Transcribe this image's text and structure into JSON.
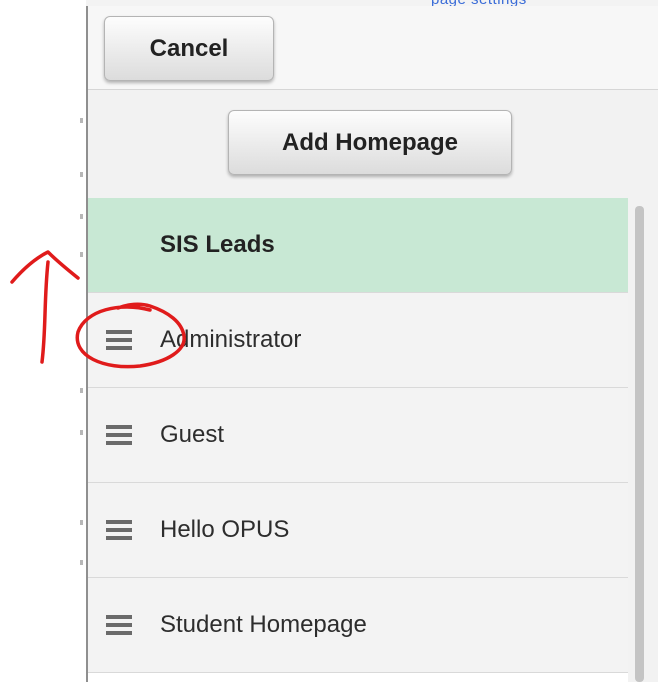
{
  "header": {
    "top_link_text": "page settings",
    "cancel_label": "Cancel"
  },
  "toolbar": {
    "add_homepage_label": "Add Homepage"
  },
  "homepages": {
    "items": [
      {
        "label": "SIS Leads",
        "selected": true
      },
      {
        "label": "Administrator",
        "selected": false
      },
      {
        "label": "Guest",
        "selected": false
      },
      {
        "label": "Hello OPUS",
        "selected": false
      },
      {
        "label": "Student Homepage",
        "selected": false
      }
    ]
  },
  "icons": {
    "drag_handle": "drag-handle-icon"
  },
  "colors": {
    "selected_row": "#c8e8d4",
    "annotation_red": "#e01b1b",
    "link_blue": "#3b6dd8"
  }
}
